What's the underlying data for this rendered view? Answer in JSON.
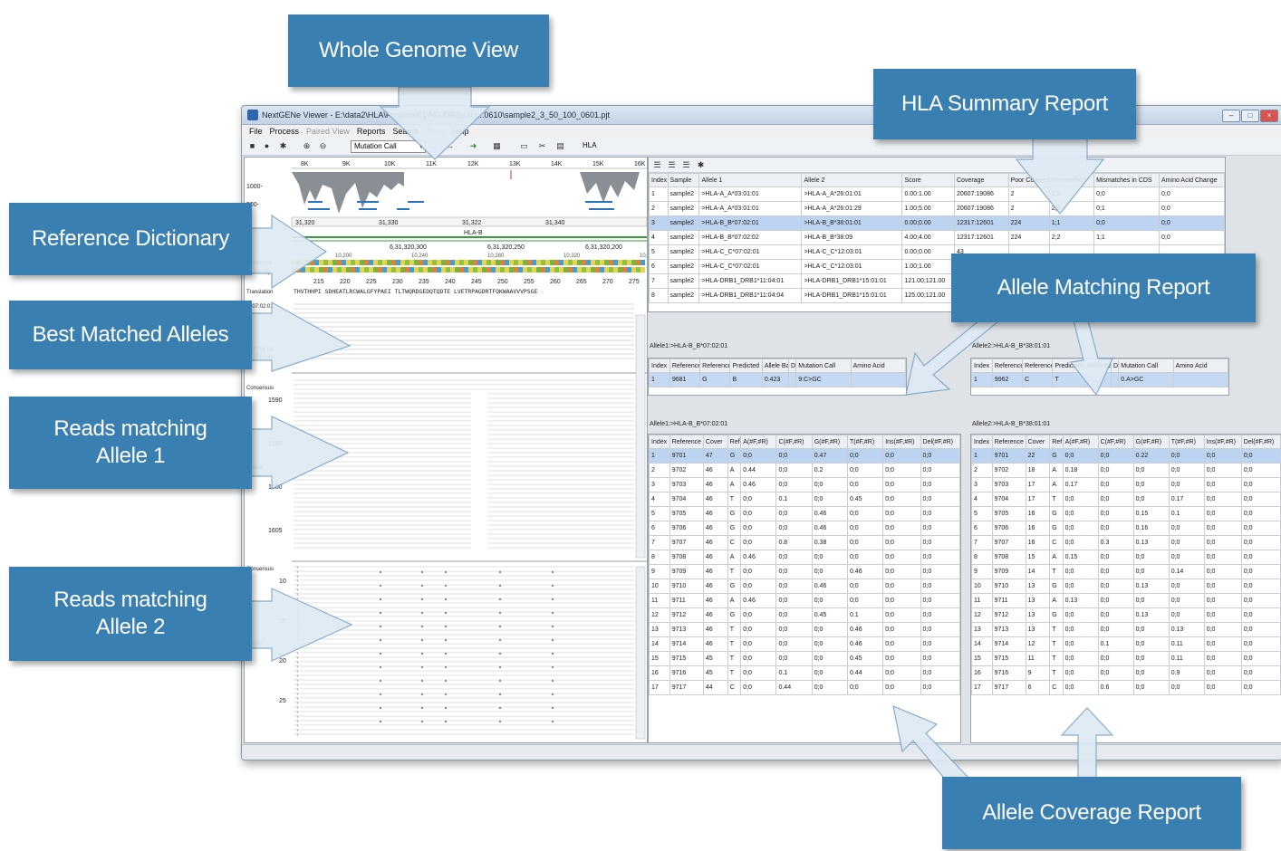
{
  "window": {
    "title": "NextGENe Viewer - E:\\data2\\HLA\\Projects\\01\\NGIOB2\\sam...0610\\sample2_3_50_100_0601.pjt"
  },
  "menu": [
    "File",
    "Process",
    "Paired View",
    "Reports",
    "Search",
    "Tools",
    "Help"
  ],
  "menu_disabled": [
    "Paired View",
    "Tools"
  ],
  "toolbar": {
    "mutation_select": "Mutation Call",
    "hla_select": "HLA"
  },
  "genome": {
    "axis_ticks": [
      "8K",
      "9K",
      "10K",
      "11K",
      "12K",
      "13K",
      "14K",
      "15K",
      "16K"
    ],
    "y_labels": [
      "1000-",
      "500-"
    ],
    "positions": [
      "31,320",
      "31,330",
      "31,322",
      "31,340"
    ],
    "gene": "HLA-B",
    "coords_top": [
      "6,31,320,300",
      "6,31,320,250",
      "6,31,320,200"
    ],
    "coords_small": [
      "10,200",
      "10,240",
      "10,280",
      "10,320",
      "10,360"
    ],
    "aa_numbers": [
      "215",
      "220",
      "225",
      "230",
      "235",
      "240",
      "245",
      "250",
      "255",
      "260",
      "265",
      "270",
      "275"
    ],
    "translation": "THVTHHPI SDHEATLRCWALGFYPAEI TLTWQRDGEDQTQDTE LVETRPAGDRTFQKWAAVVVPSGE",
    "labels": {
      "reference": "Reference",
      "dictionary": "Dictionary",
      "translation": "Translation",
      "consensus": "Consensus",
      "allele1": "Allele1",
      "allele2": "Allele2"
    },
    "best_alleles": [
      "B*07:02:05",
      "B*07:02:04"
    ],
    "allele_top": "B*07:02:01",
    "read_numbers_1": [
      "1590",
      "1595",
      "1600",
      "1605"
    ],
    "read_numbers_2": [
      "10",
      "15",
      "20",
      "25"
    ]
  },
  "summary": {
    "headers": [
      "Index",
      "Sample",
      "Allele 1",
      "Allele 2",
      "Score",
      "Coverage",
      "Poor Covered",
      "Mismatches",
      "Mismatches in CDS",
      "Amino Acid Change"
    ],
    "rows": [
      [
        "1",
        "sample2",
        ">HLA-A_A*03:01:01",
        ">HLA-A_A*26:01:01",
        "0.00:1.00",
        "20607:19086",
        "2",
        "1;2",
        "0;0",
        "0;0"
      ],
      [
        "2",
        "sample2",
        ">HLA-A_A*03:01:01",
        ">HLA-A_A*26:01:29",
        "1.00;5.00",
        "20607:19086",
        "2",
        "2;3",
        "0;1",
        "0;0"
      ],
      [
        "3",
        "sample2",
        ">HLA-B_B*07:02:01",
        ">HLA-B_B*38:01:01",
        "0.00;0.00",
        "12317:12601",
        "224",
        "1;1",
        "0;0",
        "0;0"
      ],
      [
        "4",
        "sample2",
        ">HLA-B_B*07:02:02",
        ">HLA-B_B*38:09",
        "4.00;4.00",
        "12317:12601",
        "224",
        "2;2",
        "1;1",
        "0;0"
      ],
      [
        "5",
        "sample2",
        ">HLA-C_C*07:02:01",
        ">HLA-C_C*12:03:01",
        "0.00;0.00",
        "43",
        "",
        "",
        "",
        ""
      ],
      [
        "6",
        "sample2",
        ">HLA-C_C*07:02:01",
        ">HLA-C_C*12:03:01",
        "1.00;1.00",
        "43",
        "",
        "",
        "",
        ""
      ],
      [
        "7",
        "sample2",
        ">HLA-DRB1_DRB1*11:04:01",
        ">HLA-DRB1_DRB1*15:01:01",
        "121.00;121.00",
        "33",
        "",
        "",
        "",
        ""
      ],
      [
        "8",
        "sample2",
        ">HLA-DRB1_DRB1*11:04:04",
        ">HLA-DRB1_DRB1*15:01:01",
        "125.00;121.00",
        "33",
        "",
        "",
        "",
        ""
      ]
    ]
  },
  "match1": {
    "label": "Allele1:>HLA-B_B*07:02:01",
    "headers": [
      "Index",
      "Reference",
      "Reference",
      "Predicted",
      "Allele Bal",
      "D",
      "Mutation Call",
      "Amino Acid"
    ],
    "rows": [
      [
        "1",
        "9681",
        "G",
        "B",
        "0.423",
        "",
        "9:C>GC",
        ""
      ]
    ]
  },
  "match2": {
    "label": "Allele2:>HLA-B_B*38:01:01",
    "headers": [
      "Index",
      "Reference",
      "Reference",
      "Predicted",
      "Allele Bal",
      "D",
      "Mutation Call",
      "Amino Acid"
    ],
    "rows": [
      [
        "1",
        "9962",
        "C",
        "T",
        "",
        "",
        "0.A>GC",
        ""
      ]
    ]
  },
  "cov1": {
    "label": "Allele1:>HLA-B_B*07:02:01",
    "headers": [
      "Index",
      "Reference",
      "Cover",
      "Ref",
      "A(#F,#R)",
      "C(#F,#R)",
      "G(#F,#R)",
      "T(#F,#R)",
      "Ins(#F,#R)",
      "Del(#F,#R)"
    ],
    "rows": [
      [
        "1",
        "9701",
        "47",
        "G",
        "0;0",
        "0;0",
        "0.47",
        "0;0",
        "0;0",
        "0;0"
      ],
      [
        "2",
        "9702",
        "46",
        "A",
        "0.44",
        "0;0",
        "0.2",
        "0;0",
        "0;0",
        "0;0"
      ],
      [
        "3",
        "9703",
        "46",
        "A",
        "0.46",
        "0;0",
        "0;0",
        "0;0",
        "0;0",
        "0;0"
      ],
      [
        "4",
        "9704",
        "46",
        "T",
        "0;0",
        "0.1",
        "0;0",
        "0.45",
        "0;0",
        "0;0"
      ],
      [
        "5",
        "9705",
        "46",
        "G",
        "0;0",
        "0;0",
        "0.46",
        "0;0",
        "0;0",
        "0;0"
      ],
      [
        "6",
        "9706",
        "46",
        "G",
        "0;0",
        "0;0",
        "0.46",
        "0;0",
        "0;0",
        "0;0"
      ],
      [
        "7",
        "9707",
        "46",
        "C",
        "0;0",
        "0.8",
        "0.38",
        "0;0",
        "0;0",
        "0;0"
      ],
      [
        "8",
        "9708",
        "46",
        "A",
        "0.46",
        "0;0",
        "0;0",
        "0;0",
        "0;0",
        "0;0"
      ],
      [
        "9",
        "9709",
        "46",
        "T",
        "0;0",
        "0;0",
        "0;0",
        "0.46",
        "0;0",
        "0;0"
      ],
      [
        "10",
        "9710",
        "46",
        "G",
        "0;0",
        "0;0",
        "0.46",
        "0;0",
        "0;0",
        "0;0"
      ],
      [
        "11",
        "9711",
        "46",
        "A",
        "0.46",
        "0;0",
        "0;0",
        "0;0",
        "0;0",
        "0;0"
      ],
      [
        "12",
        "9712",
        "46",
        "G",
        "0;0",
        "0;0",
        "0.45",
        "0.1",
        "0;0",
        "0;0"
      ],
      [
        "13",
        "9713",
        "46",
        "T",
        "0;0",
        "0;0",
        "0;0",
        "0.46",
        "0;0",
        "0;0"
      ],
      [
        "14",
        "9714",
        "46",
        "T",
        "0;0",
        "0;0",
        "0;0",
        "0.46",
        "0;0",
        "0;0"
      ],
      [
        "15",
        "9715",
        "45",
        "T",
        "0;0",
        "0;0",
        "0;0",
        "0.45",
        "0;0",
        "0;0"
      ],
      [
        "16",
        "9716",
        "45",
        "T",
        "0;0",
        "0.1",
        "0;0",
        "0.44",
        "0;0",
        "0;0"
      ],
      [
        "17",
        "9717",
        "44",
        "C",
        "0;0",
        "0.44",
        "0;0",
        "0;0",
        "0;0",
        "0;0"
      ]
    ]
  },
  "cov2": {
    "label": "Allele2:>HLA-B_B*38:01:01",
    "headers": [
      "Index",
      "Reference",
      "Cover",
      "Ref",
      "A(#F,#R)",
      "C(#F,#R)",
      "G(#F,#R)",
      "T(#F,#R)",
      "Ins(#F,#R)",
      "Del(#F,#R)"
    ],
    "rows": [
      [
        "1",
        "9701",
        "22",
        "G",
        "0;0",
        "0;0",
        "0.22",
        "0;0",
        "0;0",
        "0;0"
      ],
      [
        "2",
        "9702",
        "18",
        "A",
        "0.18",
        "0;0",
        "0;0",
        "0;0",
        "0;0",
        "0;0"
      ],
      [
        "3",
        "9703",
        "17",
        "A",
        "0.17",
        "0;0",
        "0;0",
        "0;0",
        "0;0",
        "0;0"
      ],
      [
        "4",
        "9704",
        "17",
        "T",
        "0;0",
        "0;0",
        "0;0",
        "0.17",
        "0;0",
        "0;0"
      ],
      [
        "5",
        "9705",
        "16",
        "G",
        "0;0",
        "0;0",
        "0.15",
        "0.1",
        "0;0",
        "0;0"
      ],
      [
        "6",
        "9706",
        "16",
        "G",
        "0;0",
        "0;0",
        "0.16",
        "0;0",
        "0;0",
        "0;0"
      ],
      [
        "7",
        "9707",
        "16",
        "C",
        "0;0",
        "0.3",
        "0.13",
        "0;0",
        "0;0",
        "0;0"
      ],
      [
        "8",
        "9708",
        "15",
        "A",
        "0.15",
        "0;0",
        "0;0",
        "0;0",
        "0;0",
        "0;0"
      ],
      [
        "9",
        "9709",
        "14",
        "T",
        "0;0",
        "0;0",
        "0;0",
        "0.14",
        "0;0",
        "0;0"
      ],
      [
        "10",
        "9710",
        "13",
        "G",
        "0;0",
        "0;0",
        "0.13",
        "0;0",
        "0;0",
        "0;0"
      ],
      [
        "11",
        "9711",
        "13",
        "A",
        "0.13",
        "0;0",
        "0;0",
        "0;0",
        "0;0",
        "0;0"
      ],
      [
        "12",
        "9712",
        "13",
        "G",
        "0;0",
        "0;0",
        "0.13",
        "0;0",
        "0;0",
        "0;0"
      ],
      [
        "13",
        "9713",
        "13",
        "T",
        "0;0",
        "0;0",
        "0;0",
        "0.13",
        "0;0",
        "0;0"
      ],
      [
        "14",
        "9714",
        "12",
        "T",
        "0;0",
        "0.1",
        "0;0",
        "0.11",
        "0;0",
        "0;0"
      ],
      [
        "15",
        "9715",
        "11",
        "T",
        "0;0",
        "0;0",
        "0;0",
        "0.11",
        "0;0",
        "0;0"
      ],
      [
        "16",
        "9716",
        "9",
        "T",
        "0;0",
        "0;0",
        "0;0",
        "0.9",
        "0;0",
        "0;0"
      ],
      [
        "17",
        "9717",
        "6",
        "C",
        "0;0",
        "0.6",
        "0;0",
        "0;0",
        "0;0",
        "0;0"
      ]
    ]
  },
  "callouts": {
    "whole_genome": "Whole Genome View",
    "hla_summary": "HLA Summary Report",
    "reference_dictionary": "Reference Dictionary",
    "best_matched": "Best Matched Alleles",
    "allele_matching": "Allele Matching Report",
    "reads1_line1": "Reads matching",
    "reads1_line2": "Allele 1",
    "reads2_line1": "Reads matching",
    "reads2_line2": "Allele 2",
    "allele_coverage": "Allele Coverage Report"
  },
  "colors": {
    "callout": "#3a7fb2",
    "selection": "#bcd4f1",
    "coverage": "#8a8f96"
  }
}
